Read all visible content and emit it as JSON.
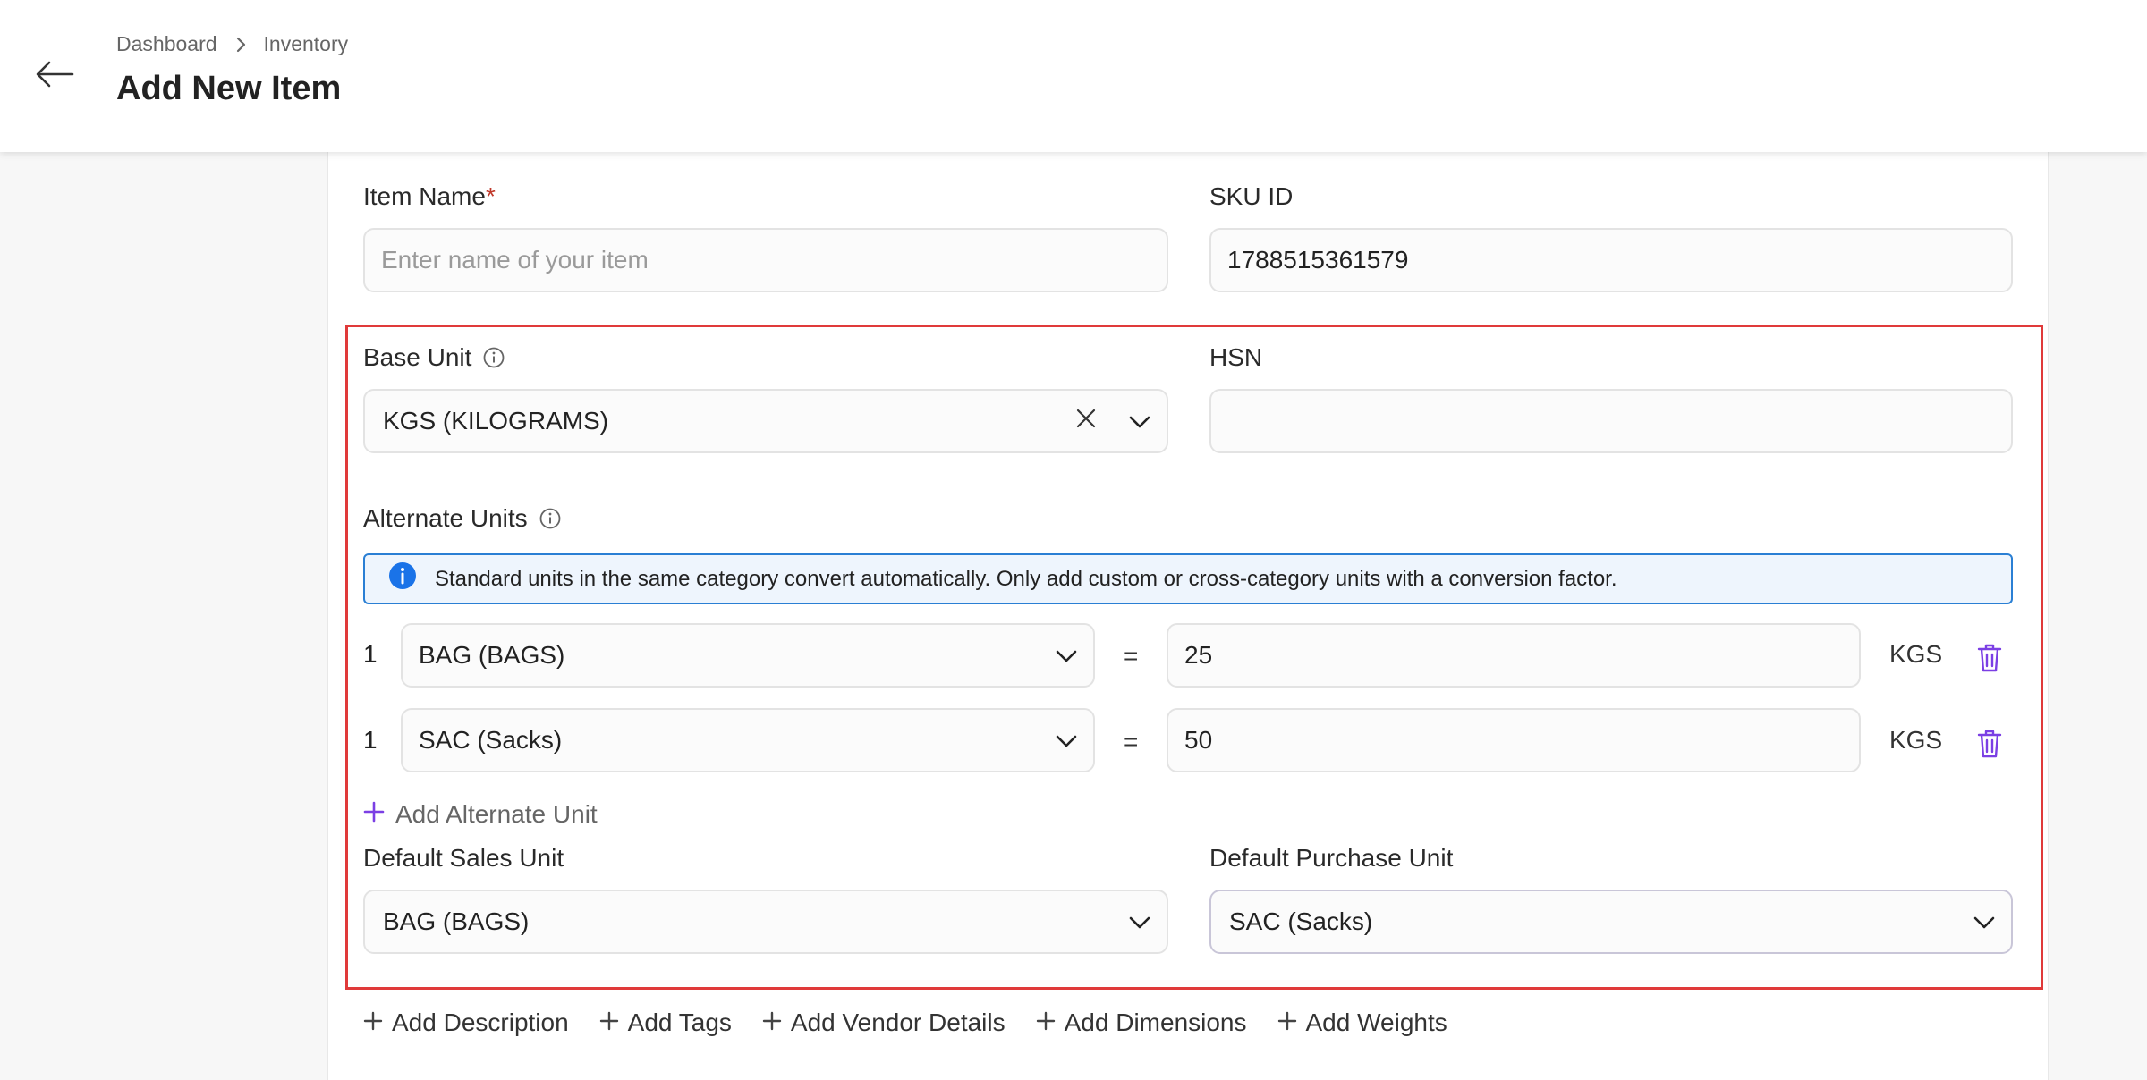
{
  "header": {
    "breadcrumb": [
      "Dashboard",
      "Inventory"
    ],
    "title": "Add New Item"
  },
  "form": {
    "item_name": {
      "label": "Item Name",
      "required_mark": "*",
      "placeholder": "Enter name of your item",
      "value": ""
    },
    "sku": {
      "label": "SKU ID",
      "value": "1788515361579"
    },
    "base_unit": {
      "label": "Base Unit",
      "value": "KGS (KILOGRAMS)"
    },
    "hsn": {
      "label": "HSN",
      "value": ""
    },
    "alternate_units": {
      "label": "Alternate Units",
      "info_banner": "Standard units in the same category convert automatically. Only add custom or cross-category units with a conversion factor.",
      "rows": [
        {
          "qty": "1",
          "unit": "BAG (BAGS)",
          "equals": "=",
          "factor": "25",
          "base": "KGS"
        },
        {
          "qty": "1",
          "unit": "SAC (Sacks)",
          "equals": "=",
          "factor": "50",
          "base": "KGS"
        }
      ],
      "add_label": "Add Alternate Unit"
    },
    "default_sales_unit": {
      "label": "Default Sales Unit",
      "value": "BAG (BAGS)"
    },
    "default_purchase_unit": {
      "label": "Default Purchase Unit",
      "value": "SAC (Sacks)"
    }
  },
  "links": [
    "Add Description",
    "Add Tags",
    "Add Vendor Details",
    "Add Dimensions",
    "Add Weights"
  ],
  "colors": {
    "accent": "#7b3fe4",
    "highlight": "#e03a3a",
    "info": "#2a7fd4",
    "required": "#c0392b"
  }
}
